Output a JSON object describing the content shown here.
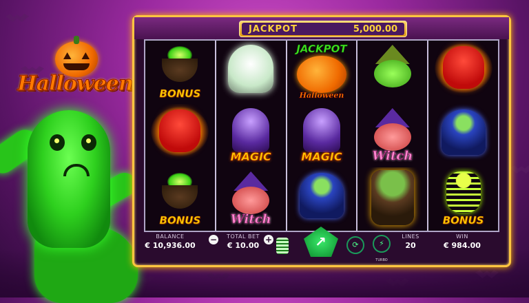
{
  "game": {
    "logo_text": "Halloween",
    "jackpot": {
      "label": "JACKPOT",
      "value": "5,000.00"
    }
  },
  "reels": [
    [
      {
        "symbol": "cauldron",
        "label": "BONUS"
      },
      {
        "symbol": "devil",
        "label": ""
      },
      {
        "symbol": "cauldron",
        "label": "BONUS"
      }
    ],
    [
      {
        "symbol": "ghost",
        "label": ""
      },
      {
        "symbol": "wizard",
        "label": "MAGIC"
      },
      {
        "symbol": "witch",
        "label": "Witch"
      }
    ],
    [
      {
        "symbol": "pumpkin-jackpot",
        "label": "JACKPOT",
        "sub": "Halloween"
      },
      {
        "symbol": "wizard",
        "label": "MAGIC"
      },
      {
        "symbol": "vampire",
        "label": ""
      }
    ],
    [
      {
        "symbol": "witch-green",
        "label": ""
      },
      {
        "symbol": "witch",
        "label": "Witch"
      },
      {
        "symbol": "frankenstein",
        "label": ""
      }
    ],
    [
      {
        "symbol": "devil",
        "label": ""
      },
      {
        "symbol": "vampire",
        "label": ""
      },
      {
        "symbol": "skeleton",
        "label": "BONUS"
      }
    ]
  ],
  "controls": {
    "balance_label": "BALANCE",
    "balance_value": "€ 10,936.00",
    "total_bet_label": "TOTAL BET",
    "total_bet_value": "€ 10.00",
    "minus": "−",
    "plus": "+",
    "turbo_label": "TURBO",
    "lines_label": "LINES",
    "lines_value": "20",
    "win_label": "WIN",
    "win_value": "€ 984.00"
  },
  "colors": {
    "frame": "#ffc640",
    "background": "#9b2aa0",
    "spin": "#20d060"
  }
}
